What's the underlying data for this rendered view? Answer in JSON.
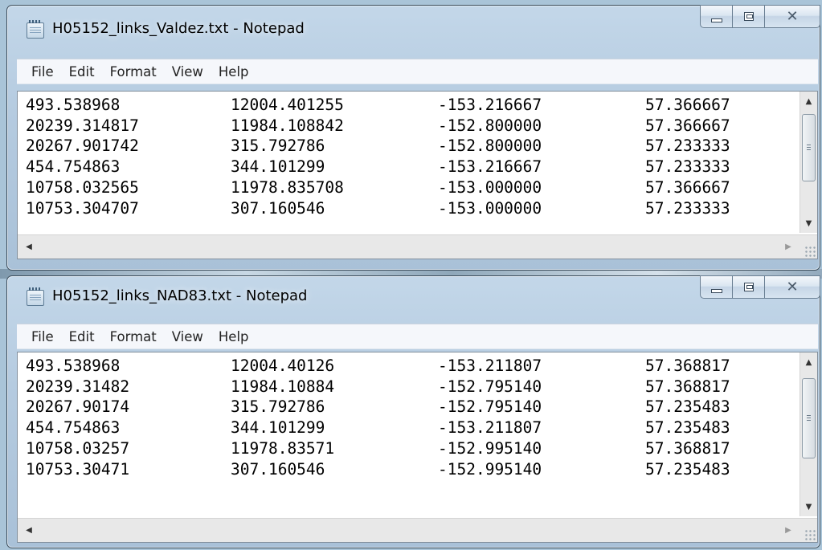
{
  "windows": [
    {
      "title": "H05152_links_Valdez.txt - Notepad",
      "menu": [
        "File",
        "Edit",
        "Format",
        "View",
        "Help"
      ],
      "rows": [
        [
          "493.538968",
          "12004.401255",
          "-153.216667",
          "57.366667"
        ],
        [
          "20239.314817",
          "11984.108842",
          "-152.800000",
          "57.366667"
        ],
        [
          "20267.901742",
          "315.792786",
          "-152.800000",
          "57.233333"
        ],
        [
          "454.754863",
          "344.101299",
          "-153.216667",
          "57.233333"
        ],
        [
          "10758.032565",
          "11978.835708",
          "-153.000000",
          "57.366667"
        ],
        [
          "10753.304707",
          "307.160546",
          "-153.000000",
          "57.233333"
        ]
      ]
    },
    {
      "title": "H05152_links_NAD83.txt - Notepad",
      "menu": [
        "File",
        "Edit",
        "Format",
        "View",
        "Help"
      ],
      "rows": [
        [
          "493.538968",
          "12004.40126",
          "-153.211807",
          "57.368817"
        ],
        [
          "20239.31482",
          "11984.10884",
          "-152.795140",
          "57.368817"
        ],
        [
          "20267.90174",
          "315.792786",
          "-152.795140",
          "57.235483"
        ],
        [
          "454.754863",
          "344.101299",
          "-153.211807",
          "57.235483"
        ],
        [
          "10758.03257",
          "11978.83571",
          "-152.995140",
          "57.368817"
        ],
        [
          "10753.30471",
          "307.160546",
          "-152.995140",
          "57.235483"
        ]
      ]
    }
  ],
  "icons": {
    "app": "notepad-icon",
    "minimize": "minimize-icon",
    "maximize": "maximize-icon",
    "close": "close-icon"
  }
}
